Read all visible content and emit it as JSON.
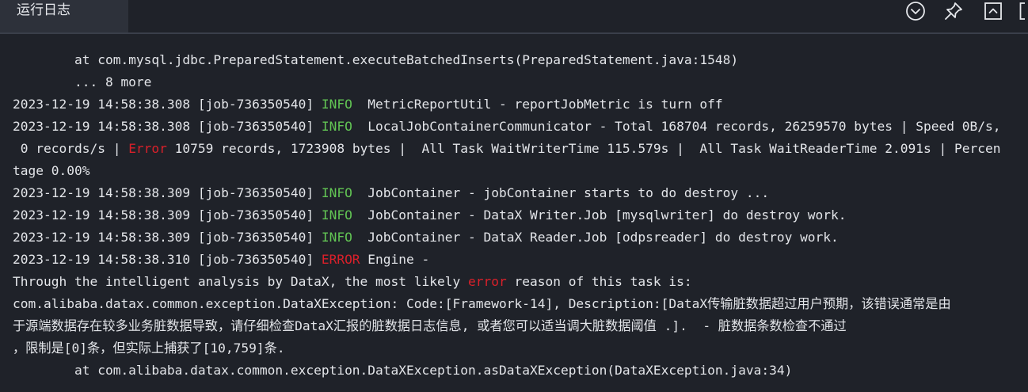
{
  "header": {
    "tab_label": "运行日志",
    "icons": [
      "chevron-down-circle-icon",
      "pin-icon",
      "maximize-icon",
      "close-icon"
    ]
  },
  "colors": {
    "background": "#1f2229",
    "tab_background": "#2d313a",
    "text": "#e3e5e9",
    "info": "#62c554",
    "error": "#d9202a"
  },
  "log": {
    "lines": [
      {
        "segments": [
          {
            "text": "        at com.mysql.jdbc.PreparedStatement.executeBatchedInserts(PreparedStatement.java:1548)",
            "style": "plain"
          }
        ]
      },
      {
        "segments": [
          {
            "text": "        ... 8 more",
            "style": "plain"
          }
        ]
      },
      {
        "segments": [
          {
            "text": "2023-12-19 14:58:38.308 [job-736350540] ",
            "style": "plain"
          },
          {
            "text": "INFO",
            "style": "info"
          },
          {
            "text": "  MetricReportUtil - reportJobMetric is turn off",
            "style": "plain"
          }
        ]
      },
      {
        "segments": [
          {
            "text": "2023-12-19 14:58:38.308 [job-736350540] ",
            "style": "plain"
          },
          {
            "text": "INFO",
            "style": "info"
          },
          {
            "text": "  LocalJobContainerCommunicator - Total 168704 records, 26259570 bytes | Speed 0B/s,",
            "style": "plain"
          }
        ]
      },
      {
        "segments": [
          {
            "text": " 0 records/s | ",
            "style": "plain"
          },
          {
            "text": "Error",
            "style": "error"
          },
          {
            "text": " 10759 records, 1723908 bytes |  All Task WaitWriterTime 115.579s |  All Task WaitReaderTime 2.091s | Percen",
            "style": "plain"
          }
        ]
      },
      {
        "segments": [
          {
            "text": "tage 0.00%",
            "style": "plain"
          }
        ]
      },
      {
        "segments": [
          {
            "text": "2023-12-19 14:58:38.309 [job-736350540] ",
            "style": "plain"
          },
          {
            "text": "INFO",
            "style": "info"
          },
          {
            "text": "  JobContainer - jobContainer starts to do destroy ...",
            "style": "plain"
          }
        ]
      },
      {
        "segments": [
          {
            "text": "2023-12-19 14:58:38.309 [job-736350540] ",
            "style": "plain"
          },
          {
            "text": "INFO",
            "style": "info"
          },
          {
            "text": "  JobContainer - DataX Writer.Job [mysqlwriter] do destroy work.",
            "style": "plain"
          }
        ]
      },
      {
        "segments": [
          {
            "text": "2023-12-19 14:58:38.309 [job-736350540] ",
            "style": "plain"
          },
          {
            "text": "INFO",
            "style": "info"
          },
          {
            "text": "  JobContainer - DataX Reader.Job [odpsreader] do destroy work.",
            "style": "plain"
          }
        ]
      },
      {
        "segments": [
          {
            "text": "2023-12-19 14:58:38.310 [job-736350540] ",
            "style": "plain"
          },
          {
            "text": "ERROR",
            "style": "error"
          },
          {
            "text": " Engine -",
            "style": "plain"
          }
        ]
      },
      {
        "segments": [
          {
            "text": "Through the intelligent analysis by DataX, the most likely ",
            "style": "plain"
          },
          {
            "text": "error",
            "style": "error"
          },
          {
            "text": " reason of this task is:",
            "style": "plain"
          }
        ]
      },
      {
        "segments": [
          {
            "text": "com.alibaba.datax.common.exception.DataXException: Code:[Framework-14], Description:[DataX传输脏数据超过用户预期，该错误通常是由",
            "style": "plain"
          }
        ]
      },
      {
        "segments": [
          {
            "text": "于源端数据存在较多业务脏数据导致，请仔细检查DataX汇报的脏数据日志信息, 或者您可以适当调大脏数据阈值 .].  - 脏数据条数检查不通过",
            "style": "plain"
          }
        ]
      },
      {
        "segments": [
          {
            "text": "，限制是[0]条，但实际上捕获了[10,759]条.",
            "style": "plain"
          }
        ]
      },
      {
        "segments": [
          {
            "text": "        at com.alibaba.datax.common.exception.DataXException.asDataXException(DataXException.java:34)",
            "style": "plain"
          }
        ]
      }
    ]
  }
}
